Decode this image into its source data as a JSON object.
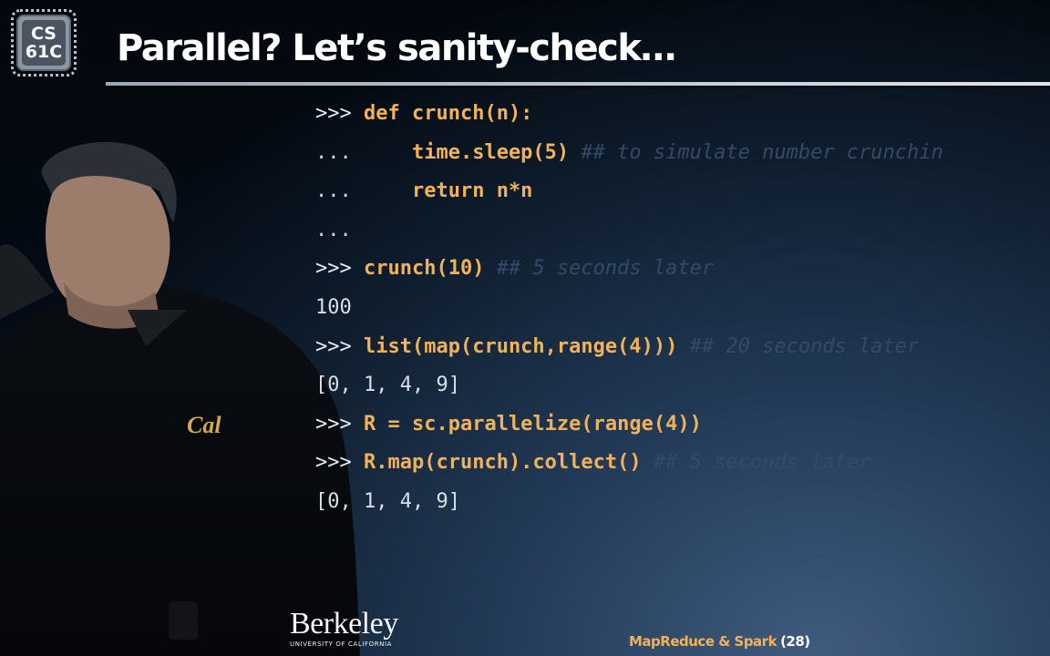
{
  "logo": {
    "line1": "CS",
    "line2": "61C"
  },
  "title": "Parallel? Let’s sanity-check…",
  "code_lines": [
    {
      "prompt": ">>>",
      "code": "def crunch(n):",
      "comment": ""
    },
    {
      "prompt": "...",
      "code": "    time.sleep(5)",
      "comment": " ## to simulate number crunchin"
    },
    {
      "prompt": "...",
      "code": "    return n*n",
      "comment": ""
    },
    {
      "prompt": "...",
      "code": "",
      "comment": ""
    },
    {
      "prompt": ">>>",
      "code": "crunch(10)",
      "comment": " ## 5 seconds later"
    },
    {
      "prompt": "100",
      "code": "",
      "comment": ""
    },
    {
      "prompt": ">>>",
      "code": "list(map(crunch,range(4)))",
      "comment": " ## 20 seconds later"
    },
    {
      "prompt": "[0, 1, 4, 9]",
      "code": "",
      "comment": ""
    },
    {
      "prompt": ">>>",
      "code": "R = sc.parallelize(range(4))",
      "comment": ""
    },
    {
      "prompt": ">>>",
      "code": "R.map(crunch).collect()",
      "comment": " ## 5 seconds later"
    },
    {
      "prompt": "[0, 1, 4, 9]",
      "code": "",
      "comment": ""
    }
  ],
  "footer": {
    "university": "Berkeley",
    "university_sub": "UNIVERSITY OF CALIFORNIA",
    "topic": "MapReduce & Spark",
    "slide_number": "(28)"
  },
  "colors": {
    "accent_orange": "#f2b25a",
    "comment_blue": "#334b66",
    "background": "#03070d"
  }
}
